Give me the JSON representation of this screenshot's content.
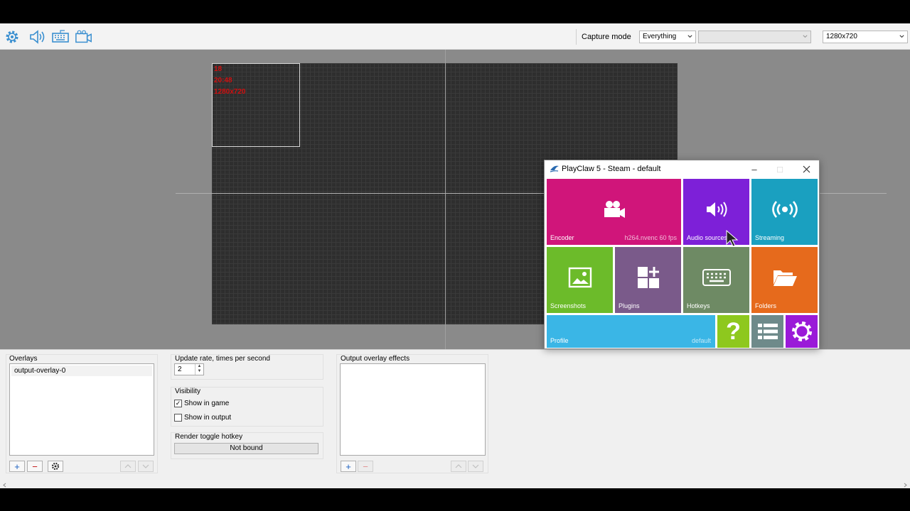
{
  "toolbar": {
    "icons": [
      "gear-icon",
      "speaker-icon",
      "keyboard-icon",
      "camera-icon"
    ],
    "capture_mode_label": "Capture mode",
    "capture_mode_value": "Everything",
    "secondary_value": "",
    "resolution_value": "1280x720"
  },
  "canvas": {
    "overlay_lines": [
      "18",
      "20:48",
      "1280x720"
    ]
  },
  "panel": {
    "overlays": {
      "title": "Overlays",
      "items": [
        "output-overlay-0"
      ]
    },
    "update_rate": {
      "title": "Update rate, times per second",
      "value": "2"
    },
    "visibility": {
      "title": "Visibility",
      "show_in_game": "Show in game",
      "show_in_game_checked": true,
      "show_in_output": "Show in output",
      "show_in_output_checked": false
    },
    "hotkey": {
      "title": "Render toggle hotkey",
      "value": "Not bound"
    },
    "effects": {
      "title": "Output overlay effects"
    }
  },
  "playclaw": {
    "title": "PlayClaw 5 - Steam - default",
    "tiles": {
      "encoder": {
        "label": "Encoder",
        "sub": "h264.nvenc 60 fps",
        "color": "#d0157a"
      },
      "audio": {
        "label": "Audio sources",
        "color": "#7d20d8"
      },
      "streaming": {
        "label": "Streaming",
        "color": "#1aa0c0"
      },
      "screenshots": {
        "label": "Screenshots",
        "color": "#6cbb2a"
      },
      "plugins": {
        "label": "Plugins",
        "color": "#7a5a8a"
      },
      "hotkeys": {
        "label": "Hotkeys",
        "color": "#6e8a64"
      },
      "folders": {
        "label": "Folders",
        "color": "#e66a1c"
      },
      "profile": {
        "label": "Profile",
        "sub": "default",
        "color": "#3ab6e6"
      },
      "help": {
        "color": "#8ec81e"
      },
      "list": {
        "color": "#6e8a8a"
      },
      "settings": {
        "color": "#9a1ad8"
      }
    }
  }
}
